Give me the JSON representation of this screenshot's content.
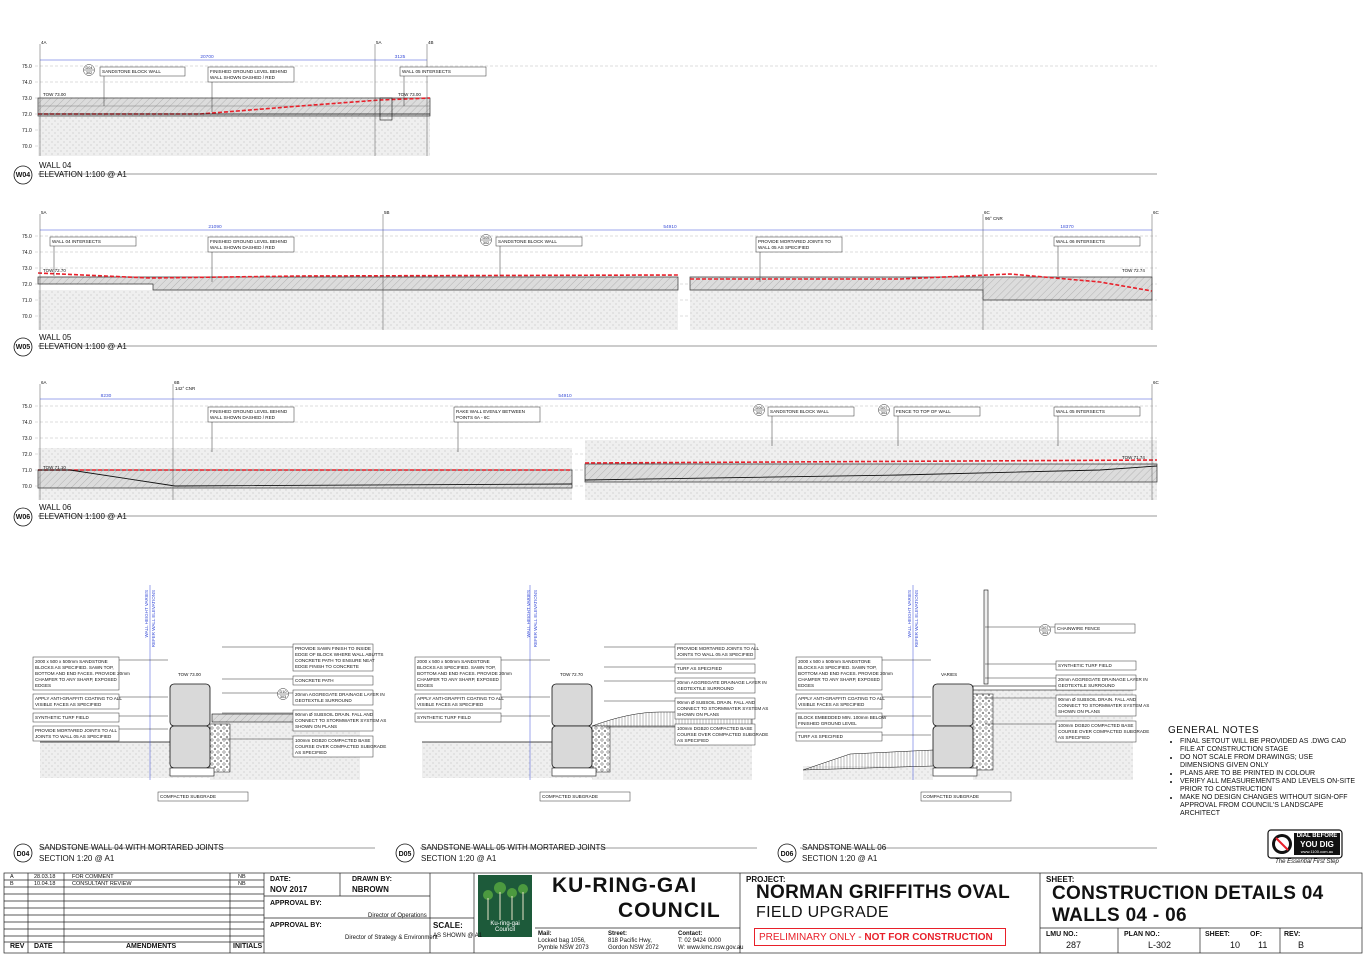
{
  "elevations": [
    {
      "code": "W04",
      "title": "WALL 04",
      "subtitle": "ELEVATION 1:100 @ A1",
      "levels": [
        "75.0",
        "74.0",
        "73.0",
        "72.0",
        "71.0",
        "70.0"
      ],
      "gridlines": [
        "4A",
        "5A",
        "4B"
      ],
      "dims": [
        "20700",
        "3125"
      ],
      "callouts": [
        "SANDSTONE BLOCK WALL",
        "FINISHED GROUND LEVEL BEHIND WALL SHOWN DASHED / RED",
        "WALL 05 INTERSECTS"
      ],
      "detail_refs": [
        {
          "num": "D04",
          "sheet": "302"
        }
      ],
      "tow": [
        "TOW 73.00",
        "TOW 73.00"
      ]
    },
    {
      "code": "W05",
      "title": "WALL 05",
      "subtitle": "ELEVATION 1:100 @ A1",
      "levels": [
        "75.0",
        "74.0",
        "73.0",
        "72.0",
        "71.0",
        "70.0"
      ],
      "gridlines": [
        "5A",
        "5B",
        "6C",
        "6C"
      ],
      "grid_note": "96° CNR",
      "dims": [
        "21090",
        "54910",
        "18370"
      ],
      "callouts": [
        "WALL 04 INTERSECTS",
        "FINISHED GROUND LEVEL BEHIND WALL SHOWN DASHED / RED",
        "SANDSTONE BLOCK WALL",
        "PROVIDE MORTARED JOINTS TO WALL 05 AS SPECIFIED",
        "WALL 06 INTERSECTS"
      ],
      "detail_refs": [
        {
          "num": "D05",
          "sheet": "302"
        }
      ],
      "tow": [
        "TOW 72.70",
        "TOW 72.74"
      ]
    },
    {
      "code": "W06",
      "title": "WALL 06",
      "subtitle": "ELEVATION 1:100 @ A1",
      "levels": [
        "75.0",
        "74.0",
        "73.0",
        "72.0",
        "71.0",
        "70.0"
      ],
      "gridlines": [
        "6A",
        "6B",
        "6C"
      ],
      "grid_note": "142° CNR",
      "dims": [
        "8230",
        "54910"
      ],
      "callouts": [
        "FINISHED GROUND LEVEL BEHIND WALL SHOWN DASHED / RED",
        "RAKE WALL EVENLY BETWEEN POINTS 6A - 6C",
        "SANDSTONE BLOCK WALL",
        "FENCE TO TOP OF WALL",
        "WALL 05 INTERSECTS"
      ],
      "detail_refs": [
        {
          "num": "D06",
          "sheet": "302"
        },
        {
          "num": "D07",
          "sheet": "303"
        }
      ],
      "tow": [
        "TOW 71.10",
        "TOW 71.74"
      ]
    }
  ],
  "sections": [
    {
      "code": "D04",
      "title": "SANDSTONE WALL 04 WITH MORTARED JOINTS",
      "subtitle": "SECTION 1:20 @ A1",
      "height_note": [
        "WALL HEIGHT VARIES",
        "REFER WALL ELEVATIONS"
      ],
      "tow": "TOW 73.00",
      "left_callouts": [
        "2000 x 500 x 500mm SANDSTONE BLOCKS AS SPECIFIED. SAWN TOP, BOTTOM AND END FACES. PROVIDE 20mm CHAMFER TO ANY SHARP, EXPOSED EDGES",
        "APPLY ANTI-GRAFFITI COATING TO ALL VISIBLE FACES AS SPECIFIED",
        "SYNTHETIC TURF FIELD",
        "PROVIDE MORTARED JOINTS TO ALL JOINTS TO WALL 05 AS SPECIFIED"
      ],
      "right_callouts": [
        "PROVIDE SAWN FINISH TO INSIDE EDGE OF BLOCK WHERE WALL ABUTTS CONCRETE PATH TO ENSURE NEAT EDGE FINISH TO CONCRETE",
        "CONCRETE PATH",
        "20mm AGGREGATE DRAINAGE LAYER IN GEOTEXTILE SURROUND",
        "90mm Ø SUBSOIL DRAIN. FALL AND CONNECT TO STORMWATER SYSTEM AS SHOWN ON PLANS",
        "100mm DGB20 COMPACTED BASE COURSE OVER COMPACTED SUBGRADE AS SPECIFIED"
      ],
      "detail_ref": {
        "num": "D10",
        "sheet": "303"
      },
      "subgrade": "COMPACTED SUBGRADE"
    },
    {
      "code": "D05",
      "title": "SANDSTONE WALL 05 WITH MORTARED JOINTS",
      "subtitle": "SECTION 1:20 @ A1",
      "height_note": [
        "WALL HEIGHT VARIES",
        "REFER WALL ELEVATIONS"
      ],
      "tow": "TOW 72.70",
      "left_callouts": [
        "2000 x 500 x 500mm SANDSTONE BLOCKS AS SPECIFIED. SAWN TOP, BOTTOM AND END FACES. PROVIDE 20mm CHAMFER TO ANY SHARP, EXPOSED EDGES",
        "APPLY ANTI-GRAFFITI COATING TO ALL VISIBLE FACES AS SPECIFIED",
        "SYNTHETIC TURF FIELD"
      ],
      "right_callouts": [
        "PROVIDE MORTARED JOINTS TO ALL JOINTS TO WALL 05 AS SPECIFIED",
        "TURF AS SPECIFIED",
        "20mm AGGREGATE DRAINAGE LAYER IN GEOTEXTILE SURROUND",
        "90mm Ø SUBSOIL DRAIN. FALL AND CONNECT TO STORMWATER SYSTEM AS SHOWN ON PLANS",
        "100mm DGB20 COMPACTED BASE COURSE OVER COMPACTED SUBGRADE AS SPECIFIED"
      ],
      "subgrade": "COMPACTED SUBGRADE"
    },
    {
      "code": "D06",
      "title": "SANDSTONE WALL 06",
      "subtitle": "SECTION 1:20 @ A1",
      "height_note": [
        "WALL HEIGHT VARIES",
        "REFER WALL ELEVATIONS"
      ],
      "tow": "VARIES",
      "left_callouts": [
        "2000 x 500 x 500mm SANDSTONE BLOCKS AS SPECIFIED. SAWN TOP, BOTTOM AND END FACES. PROVIDE 20mm CHAMFER TO ANY SHARP, EXPOSED EDGES",
        "APPLY ANTI-GRAFFITI COATING TO ALL VISIBLE FACES AS SPECIFIED",
        "BLOCK EMBEDDED MIN. 100mm BELOW FINISHED GROUND LEVEL",
        "TURF AS SPECIFIED"
      ],
      "right_callouts": [
        "CHAINWIRE FENCE",
        "SYNTHETIC TURF FIELD",
        "20mm AGGREGATE DRAINAGE LAYER IN GEOTEXTILE SURROUND",
        "90mm Ø SUBSOIL DRAIN. FALL AND CONNECT TO STORMWATER SYSTEM AS SHOWN ON PLANS",
        "100mm DGB20 COMPACTED BASE COURSE OVER COMPACTED SUBGRADE AS SPECIFIED"
      ],
      "detail_ref": {
        "num": "D07",
        "sheet": "303"
      },
      "subgrade": "COMPACTED SUBGRADE"
    }
  ],
  "general_notes": {
    "title": "GENERAL NOTES",
    "items": [
      "FINAL SETOUT WILL BE PROVIDED AS .DWG CAD FILE AT CONSTRUCTION STAGE",
      "DO NOT SCALE FROM DRAWINGS; USE DIMENSIONS GIVEN ONLY",
      "PLANS ARE TO BE PRINTED IN COLOUR",
      "VERIFY ALL MEASUREMENTS AND LEVELS ON-SITE PRIOR TO CONSTRUCTION",
      "MAKE NO DESIGN CHANGES WITHOUT SIGN-OFF APPROVAL FROM COUNCIL'S LANDSCAPE ARCHITECT"
    ]
  },
  "dial_before": {
    "line1": "DIAL BEFORE",
    "line2": "YOU DIG",
    "url": "www.1100.com.au",
    "tagline": "The Essential First Step"
  },
  "title_block": {
    "revisions": [
      {
        "rev": "A",
        "date": "28.03.18",
        "amendment": "FOR COMMENT",
        "initials": "NB"
      },
      {
        "rev": "B",
        "date": "10.04.18",
        "amendment": "CONSULTANT REVIEW",
        "initials": "NB"
      }
    ],
    "rev_headers": [
      "REV",
      "DATE",
      "AMENDMENTS",
      "INITIALS"
    ],
    "date_label": "DATE:",
    "date": "NOV 2017",
    "drawn_label": "DRAWN BY:",
    "drawn": "NBROWN",
    "approval_label": "APPROVAL BY:",
    "approval1_role": "Director of Operations",
    "approval2_role": "Director of Strategy & Environment",
    "scale_label": "SCALE:",
    "scale": "AS SHOWN @ A1",
    "council_line1": "KU-RING-GAI",
    "council_line2": "COUNCIL",
    "logo_text1": "Ku-ring-gai",
    "logo_text2": "Council",
    "mail_label": "Mail:",
    "mail": [
      "Locked bag 1056,",
      "Pymble NSW 2073"
    ],
    "street_label": "Street:",
    "street": [
      "818 Pacific Hwy,",
      "Gordon NSW 2072"
    ],
    "contact_label": "Contact:",
    "contact": [
      "T: 02 9424 0000",
      "W: www.kmc.nsw.gov.au"
    ],
    "project_label": "PROJECT:",
    "project": "NORMAN GRIFFITHS OVAL",
    "project2": "FIELD UPGRADE",
    "status_a": "PRELIMINARY ONLY -",
    "status_b": "NOT FOR CONSTRUCTION",
    "sheet_label": "SHEET:",
    "sheet1": "CONSTRUCTION DETAILS 04",
    "sheet2": "WALLS 04 - 06",
    "lmu_label": "LMU NO.:",
    "lmu": "287",
    "plan_label": "PLAN NO.:",
    "plan": "L-302",
    "sheetno_label": "SHEET:",
    "sheetno": "10",
    "of_label": "OF:",
    "of": "11",
    "rev_label": "REV:",
    "rev": "B"
  },
  "colors": {
    "dashed_red": "#e8202a",
    "dim_blue": "#3b4fd8",
    "wall_fill": "#d9d9d9",
    "ink": "#111111"
  }
}
